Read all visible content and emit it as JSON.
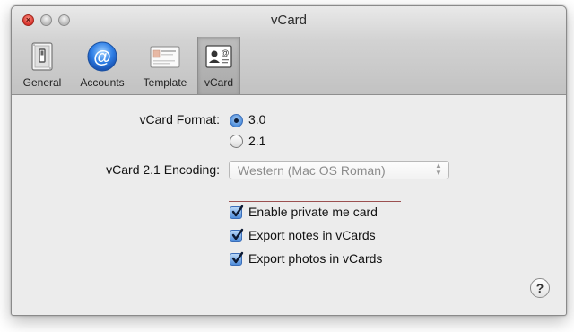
{
  "window": {
    "title": "vCard"
  },
  "toolbar": {
    "items": [
      {
        "label": "General",
        "icon": "switch-icon"
      },
      {
        "label": "Accounts",
        "icon": "at-sign-icon"
      },
      {
        "label": "Template",
        "icon": "card-template-icon"
      },
      {
        "label": "vCard",
        "icon": "vcard-icon",
        "selected": true
      }
    ]
  },
  "form": {
    "format_label": "vCard Format:",
    "format_options": [
      {
        "label": "3.0",
        "checked": true
      },
      {
        "label": "2.1",
        "checked": false
      }
    ],
    "encoding_label": "vCard 2.1 Encoding:",
    "encoding_value": "Western (Mac OS Roman)",
    "checkboxes": [
      {
        "label": "Enable private me card",
        "checked": true
      },
      {
        "label": "Export notes in vCards",
        "checked": true
      },
      {
        "label": "Export photos in vCards",
        "checked": true
      }
    ],
    "help_label": "?"
  },
  "colors": {
    "accent": "#4f8ddb",
    "close_button": "#d8302a"
  }
}
